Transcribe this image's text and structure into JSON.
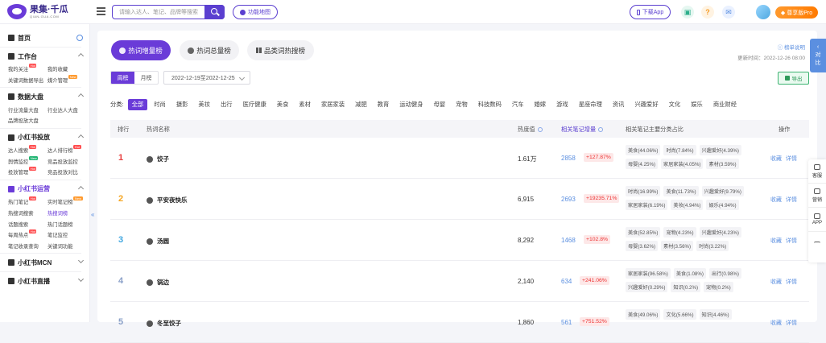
{
  "header": {
    "logo_main": "果集·千瓜",
    "logo_sub": "QIAN-GUA.COM",
    "search_placeholder": "请输入达人、笔记、品牌等搜索",
    "function_map": "功能地图",
    "download_app": "下载App",
    "help_icon": "?",
    "pro_label": "尊享版Pro"
  },
  "sidebar": {
    "home": "首页",
    "workbench": {
      "title": "工作台",
      "items": [
        {
          "label": "我的关注",
          "badge": "Hot"
        },
        {
          "label": "我的收藏"
        },
        {
          "label": "关键词数据导出"
        },
        {
          "label": "媒介管理",
          "badge": "New"
        }
      ]
    },
    "data": {
      "title": "数据大盘",
      "items": [
        {
          "label": "行业流量大盘"
        },
        {
          "label": "行业达人大盘"
        },
        {
          "label": "品牌投放大盘"
        }
      ]
    },
    "ads": {
      "title": "小红书投放",
      "items": [
        {
          "label": "达人搜索",
          "badge": "Hot"
        },
        {
          "label": "达人排行榜",
          "badge": "Hot"
        },
        {
          "label": "舆情监控",
          "badge": "New"
        },
        {
          "label": "竞品投放监控"
        },
        {
          "label": "投放管理",
          "badge": "Hot"
        },
        {
          "label": "竞品投放对比"
        }
      ]
    },
    "ops": {
      "title": "小红书运营",
      "items": [
        {
          "label": "热门笔记",
          "badge": "Hot"
        },
        {
          "label": "实时笔记榜",
          "badge": "New"
        },
        {
          "label": "热搜词搜索"
        },
        {
          "label": "热搜词榜"
        },
        {
          "label": "话题搜索"
        },
        {
          "label": "热门话题榜"
        },
        {
          "label": "每周热点",
          "badge": "Hot"
        },
        {
          "label": "笔记监控"
        },
        {
          "label": "笔记收录查询"
        },
        {
          "label": "关键词功能"
        }
      ]
    },
    "mcn": {
      "title": "小红书MCN"
    },
    "live": {
      "title": "小红书直播"
    },
    "collapse": "«"
  },
  "main": {
    "tabs": [
      {
        "label": "热词增量榜"
      },
      {
        "label": "热词总量榜"
      },
      {
        "label": "品类词热搜榜"
      }
    ],
    "rank_help": "榜单说明",
    "update_time": "更新时间：2022-12-26 08:00",
    "period": [
      "周榜",
      "月榜"
    ],
    "date_range": "2022-12-19至2022-12-25",
    "export": "导出",
    "category_label": "分类:",
    "categories": [
      "全部",
      "时尚",
      "摄影",
      "美妆",
      "出行",
      "医疗健康",
      "美食",
      "素材",
      "家居家装",
      "减肥",
      "教育",
      "运动健身",
      "母婴",
      "宠物",
      "科技数码",
      "汽车",
      "婚嫁",
      "游戏",
      "星座命理",
      "资讯",
      "兴趣爱好",
      "文化",
      "娱乐",
      "商业财经"
    ],
    "columns": {
      "rank": "排行",
      "name": "热词名称",
      "heat": "热度值",
      "notes": "相关笔记增量",
      "share": "相关笔记主要分类占比",
      "ops": "操作"
    },
    "rows": [
      {
        "rank": "1",
        "name": "饺子",
        "heat": "1.61万",
        "notes": "2858",
        "growth": "+127.87%",
        "tags": [
          "美食(44.06%)",
          "时尚(7.84%)",
          "兴趣爱好(4.39%)",
          "母婴(4.25%)",
          "家居家装(4.05%)",
          "素材(3.59%)"
        ]
      },
      {
        "rank": "2",
        "name": "平安夜快乐",
        "heat": "6,915",
        "notes": "2693",
        "growth": "+19235.71%",
        "tags": [
          "时尚(16.99%)",
          "美食(11.73%)",
          "兴趣爱好(9.79%)",
          "家居家装(6.19%)",
          "美妆(4.94%)",
          "娱乐(4.94%)"
        ]
      },
      {
        "rank": "3",
        "name": "汤圆",
        "heat": "8,292",
        "notes": "1468",
        "growth": "+102.8%",
        "tags": [
          "美食(52.85%)",
          "宠物(4.23%)",
          "兴趣爱好(4.23%)",
          "母婴(3.62%)",
          "素材(3.56%)",
          "时尚(3.22%)"
        ]
      },
      {
        "rank": "4",
        "name": "锅边",
        "heat": "2,140",
        "notes": "634",
        "growth": "+241.06%",
        "tags": [
          "家居家装(96.58%)",
          "美食(1.08%)",
          "出行(0.98%)",
          "兴趣爱好(0.29%)",
          "知识(0.2%)",
          "宠物(0.2%)"
        ]
      },
      {
        "rank": "5",
        "name": "冬至饺子",
        "heat": "1,860",
        "notes": "561",
        "growth": "+751.52%",
        "tags": [
          "美食(49.06%)",
          "文化(5.66%)",
          "知识(4.46%)"
        ]
      }
    ],
    "op_collect": "收藏",
    "op_detail": "详情"
  },
  "right": {
    "compare": "对比",
    "service": "客服",
    "marketing": "营销",
    "app": "APP"
  },
  "colors": {
    "brand": "#6a3bd8",
    "link": "#5b8fe0",
    "growth": "#e33333",
    "rank_1": "#e84040",
    "rank_2": "#f5a623",
    "rank_3": "#41a7e0",
    "rank_other": "#8aa0c8"
  }
}
